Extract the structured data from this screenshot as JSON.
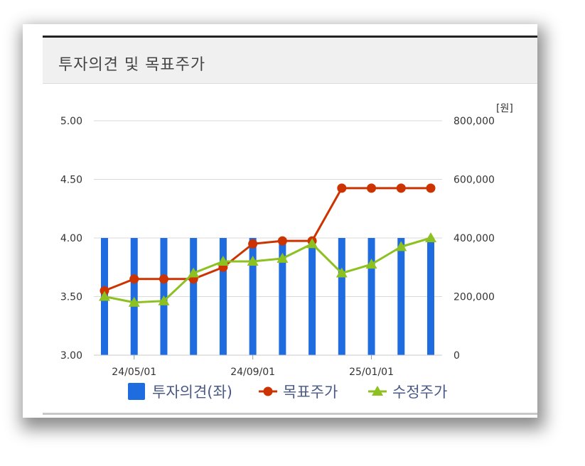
{
  "card": {
    "title": "투자의견 및 목표주가"
  },
  "chart_data": {
    "type": "bar",
    "unit_label": "[원]",
    "x_tick_labels": [
      "24/05/01",
      "24/09/01",
      "25/01/01"
    ],
    "y_left": {
      "range": [
        3.0,
        5.0
      ],
      "ticks": [
        "3.00",
        "3.50",
        "4.00",
        "4.50",
        "5.00"
      ]
    },
    "y_right": {
      "range": [
        0,
        800000
      ],
      "ticks": [
        "0",
        "200,000",
        "400,000",
        "600,000",
        "800,000"
      ]
    },
    "grid": true,
    "legend_position": "bottom",
    "series": [
      {
        "name": "투자의견(좌)",
        "type": "bar",
        "axis": "left",
        "color": "#1f6be0",
        "values": [
          4.0,
          4.0,
          4.0,
          4.0,
          4.0,
          4.0,
          4.0,
          4.0,
          4.0,
          4.0,
          4.0,
          4.0
        ]
      },
      {
        "name": "목표주가",
        "type": "line",
        "axis": "right",
        "color": "#cc3300",
        "marker": "circle",
        "values": [
          220000,
          260000,
          260000,
          260000,
          300000,
          380000,
          390000,
          390000,
          570000,
          570000,
          570000,
          570000
        ]
      },
      {
        "name": "수정주가",
        "type": "line",
        "axis": "right",
        "color": "#8cc11f",
        "marker": "triangle",
        "values": [
          200000,
          180000,
          185000,
          280000,
          320000,
          320000,
          330000,
          380000,
          280000,
          310000,
          370000,
          400000
        ]
      }
    ]
  }
}
